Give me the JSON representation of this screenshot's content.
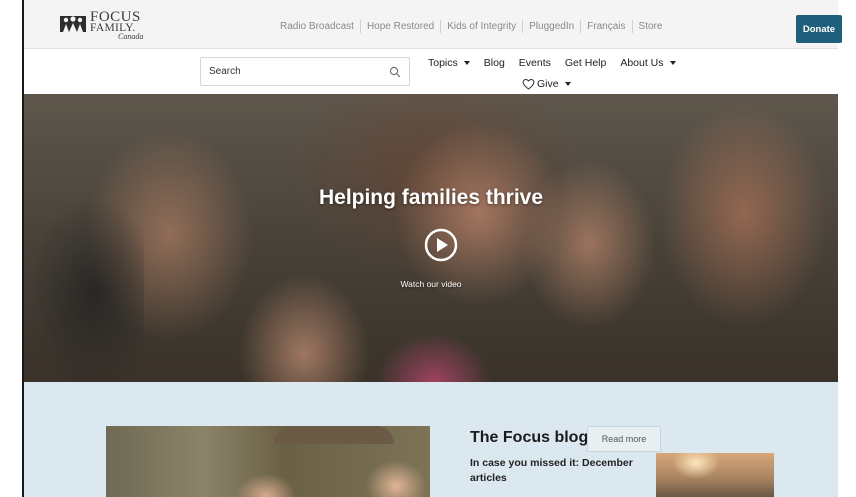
{
  "brand": {
    "logo_line1": "FOCUS",
    "logo_line2": "FAMILY.",
    "logo_country": "Canada"
  },
  "utility_nav": {
    "items": [
      "Radio Broadcast",
      "Hope Restored",
      "Kids of Integrity",
      "PluggedIn",
      "Français",
      "Store"
    ]
  },
  "donate_label": "Donate",
  "search": {
    "placeholder": "Search"
  },
  "main_nav": {
    "topics": "Topics",
    "blog": "Blog",
    "events": "Events",
    "get_help": "Get Help",
    "about": "About Us",
    "give": "Give"
  },
  "hero": {
    "title": "Helping families thrive",
    "video_label": "Watch our video"
  },
  "blog": {
    "title": "The Focus blog",
    "read_more": "Read more",
    "subtitle": "In case you missed it: December articles"
  },
  "colors": {
    "donate": "#1f5f7c",
    "blog_background": "#dce8ef"
  }
}
